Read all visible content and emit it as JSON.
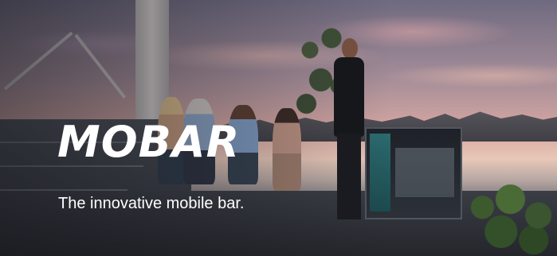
{
  "hero": {
    "brand": "MOBAR",
    "tagline": "The innovative mobile bar."
  },
  "colors": {
    "text": "#ffffff",
    "trolley_accent": "#2b6a6e"
  }
}
